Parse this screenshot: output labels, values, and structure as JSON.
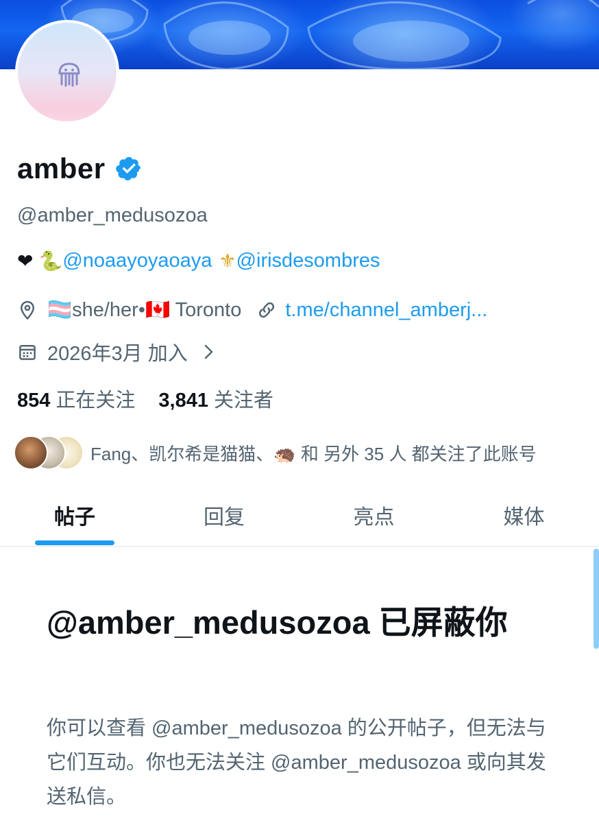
{
  "profile": {
    "display_name": "amber",
    "handle": "@amber_medusozoa",
    "bio": {
      "heart": "❤",
      "snake": "🐍",
      "mention_1": "@noaayoyaoaya",
      "fleur": "⚜",
      "mention_2": "@irisdesombres"
    },
    "location": "🏳️‍⚧️she/her•🇨🇦 Toronto",
    "link": "t.me/channel_amberj...",
    "joined": "2026年3月 加入",
    "following_count": "854",
    "following_label": "正在关注",
    "followers_count": "3,841",
    "followers_label": "关注者",
    "known_followers": "Fang、凯尔希是猫猫、🦔 和 另外 35 人 都关注了此账号"
  },
  "icons": {
    "verified": "verified-badge-icon",
    "location": "location-pin-icon",
    "link": "link-icon",
    "calendar": "calendar-icon",
    "chevron": "chevron-right-icon",
    "avatar": "jellyfish-icon"
  },
  "tabs": [
    {
      "label": "帖子",
      "active": true
    },
    {
      "label": "回复",
      "active": false
    },
    {
      "label": "亮点",
      "active": false
    },
    {
      "label": "媒体",
      "active": false
    }
  ],
  "blocked": {
    "title": "@amber_medusozoa 已屏蔽你",
    "description": "你可以查看 @amber_medusozoa 的公开帖子，但无法与它们互动。你也无法关注 @amber_medusozoa 或向其发送私信。"
  },
  "colors": {
    "accent": "#1d9bf0",
    "secondary_text": "#536471",
    "primary_text": "#0f1419",
    "banner": "#1466f0"
  }
}
